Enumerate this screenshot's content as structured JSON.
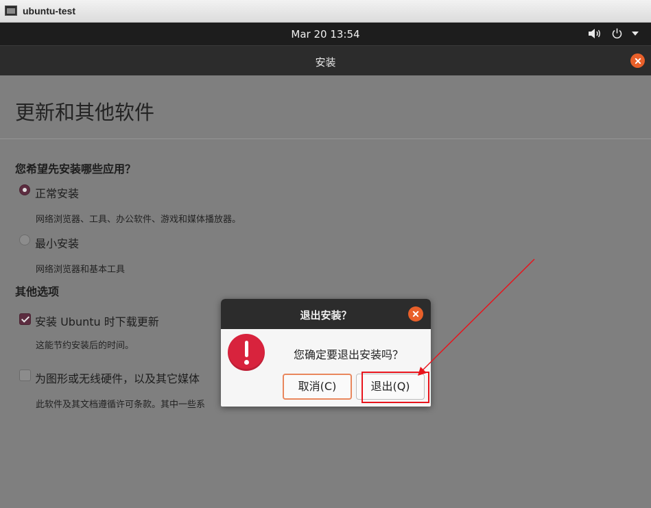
{
  "vm": {
    "title": "ubuntu-test"
  },
  "panel": {
    "clock": "Mar 20  13:54",
    "icons": [
      "network-icon",
      "volume-icon",
      "power-icon",
      "dropdown-arrow-icon"
    ]
  },
  "installer": {
    "header_title": "安装",
    "page_title": "更新和其他软件",
    "apps_question": "您希望先安装哪些应用？",
    "options": [
      {
        "label": "正常安装",
        "desc": "网络浏览器、工具、办公软件、游戏和媒体播放器。",
        "selected": true
      },
      {
        "label": "最小安装",
        "desc": "网络浏览器和基本工具",
        "selected": false
      }
    ],
    "other_heading": "其他选项",
    "checks": [
      {
        "label": "安装 Ubuntu 时下载更新",
        "desc": "这能节约安装后的时间。",
        "checked": true
      },
      {
        "label": "为图形或无线硬件，以及其它媒体",
        "desc": "此软件及其文档遵循许可条款。其中一些系",
        "checked": false
      }
    ]
  },
  "dialog": {
    "title": "退出安装？",
    "message": "您确定要退出安装吗？",
    "cancel_label": "取消(C)",
    "quit_label": "退出(Q)"
  },
  "colors": {
    "accent": "#e9602a",
    "error": "#d8233d",
    "annotation": "#e8141c",
    "selection": "#5c2d40"
  }
}
